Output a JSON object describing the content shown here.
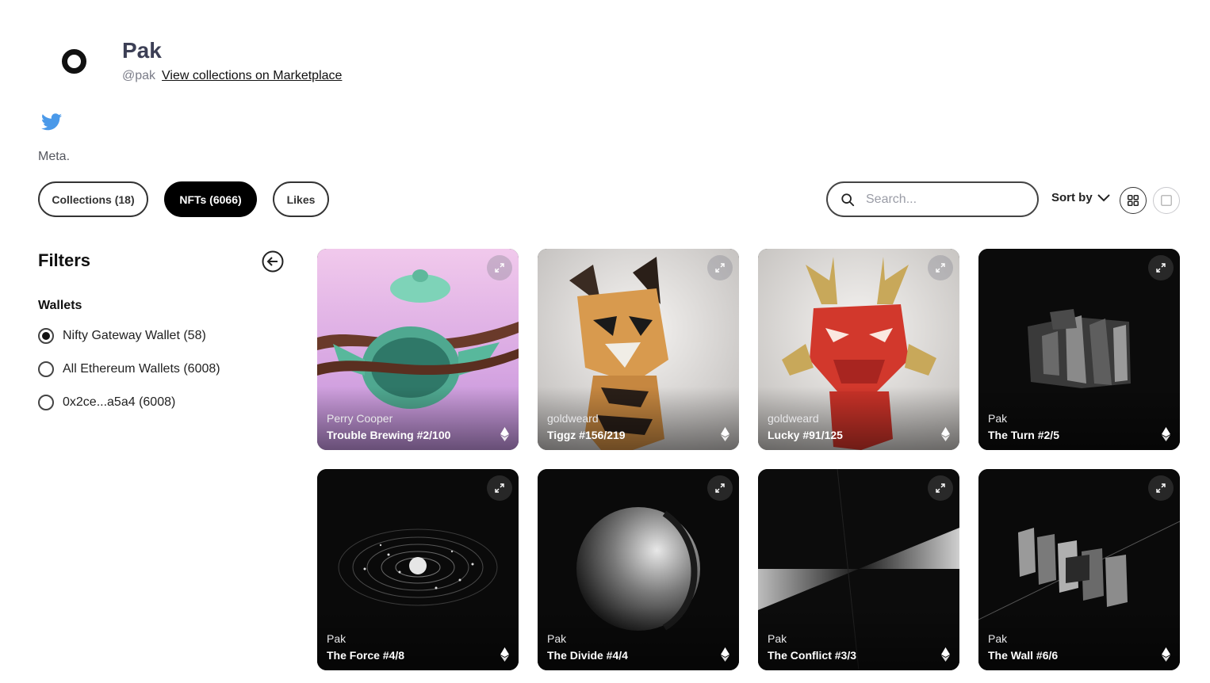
{
  "profile": {
    "name": "Pak",
    "handle": "@pak",
    "marketplace_link": "View collections on Marketplace",
    "bio": "Meta."
  },
  "tabs": [
    {
      "label": "Collections (18)",
      "active": false
    },
    {
      "label": "NFTs (6066)",
      "active": true
    },
    {
      "label": "Likes",
      "active": false
    }
  ],
  "search": {
    "placeholder": "Search..."
  },
  "sort": {
    "label": "Sort by"
  },
  "filters": {
    "title": "Filters",
    "wallets_title": "Wallets",
    "wallets": [
      {
        "label": "Nifty Gateway Wallet (58)",
        "checked": true
      },
      {
        "label": "All Ethereum Wallets (6008)",
        "checked": false
      },
      {
        "label": "0x2ce...a5a4 (6008)",
        "checked": false
      }
    ]
  },
  "nfts": [
    {
      "creator": "Perry Cooper",
      "title": "Trouble Brewing #2/100",
      "art": "teapot"
    },
    {
      "creator": "goldweard",
      "title": "Tiggz #156/219",
      "art": "tiger"
    },
    {
      "creator": "goldweard",
      "title": "Lucky #91/125",
      "art": "dragon"
    },
    {
      "creator": "Pak",
      "title": "The Turn #2/5",
      "art": "cube"
    },
    {
      "creator": "Pak",
      "title": "The Force #4/8",
      "art": "orbits"
    },
    {
      "creator": "Pak",
      "title": "The Divide #4/4",
      "art": "sphere"
    },
    {
      "creator": "Pak",
      "title": "The Conflict #3/3",
      "art": "wedge"
    },
    {
      "creator": "Pak",
      "title": "The Wall #6/6",
      "art": "wall"
    }
  ],
  "colors": {
    "accent": "#000000",
    "twitter": "#4a99e9",
    "heading": "#3c3f55"
  }
}
